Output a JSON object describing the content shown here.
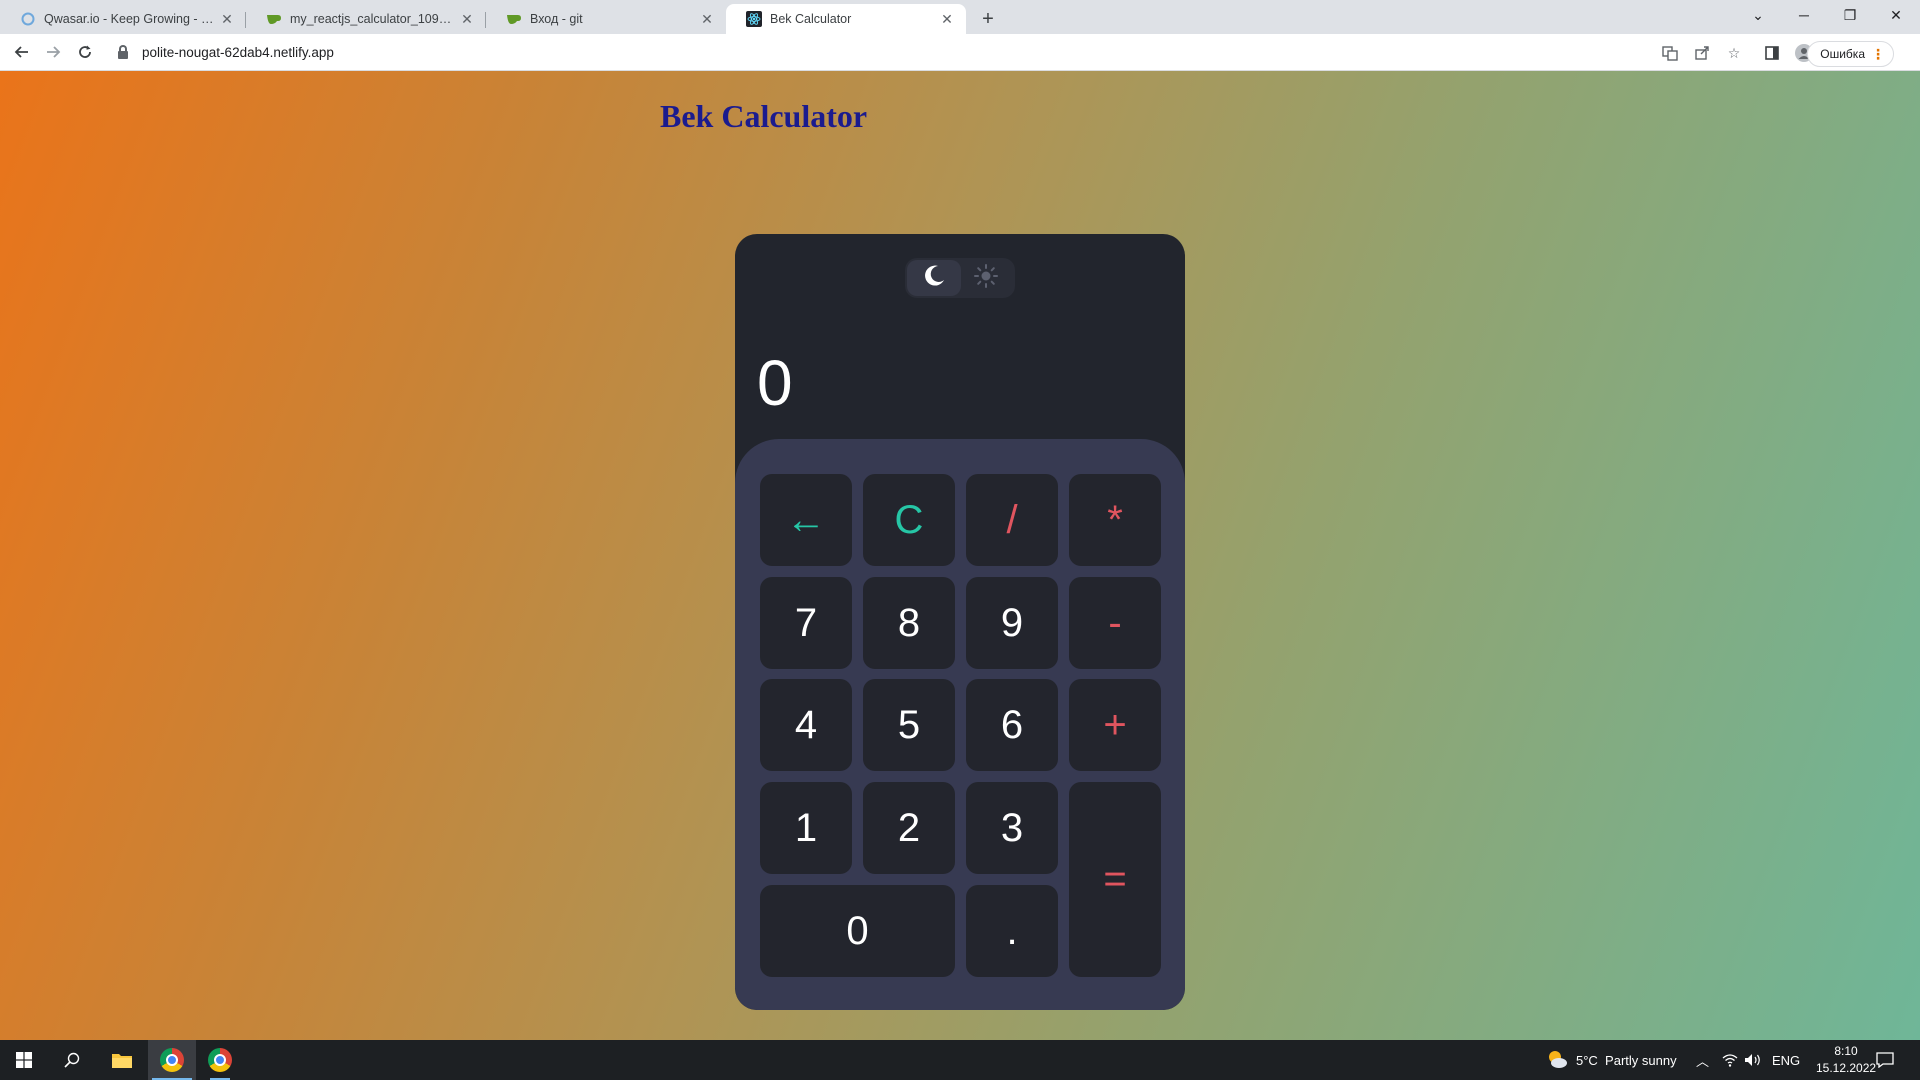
{
  "browser": {
    "tabs": [
      {
        "label": "Qwasar.io - Keep Growing - max",
        "icon": "qwasar-icon"
      },
      {
        "label": "my_reactjs_calculator_109740_or",
        "icon": "gitea-icon"
      },
      {
        "label": "Вход - git",
        "icon": "gitea-icon"
      },
      {
        "label": "Bek Calculator",
        "icon": "react-icon",
        "active": true
      }
    ],
    "url": "polite-nougat-62dab4.netlify.app",
    "error_button": "Ошибка"
  },
  "page": {
    "title": "Bek Calculator"
  },
  "calculator": {
    "display": "0",
    "theme": "dark",
    "keys": {
      "backspace": "←",
      "clear": "C",
      "divide": "/",
      "multiply": "*",
      "seven": "7",
      "eight": "8",
      "nine": "9",
      "minus": "-",
      "four": "4",
      "five": "5",
      "six": "6",
      "plus": "+",
      "one": "1",
      "two": "2",
      "three": "3",
      "equals": "=",
      "zero": "0",
      "dot": "."
    },
    "colors": {
      "accent_teal": "#26c6a6",
      "accent_red": "#e0555f",
      "body": "#22252d",
      "keypad": "#373a52"
    }
  },
  "taskbar": {
    "weather": "5°C  Partly sunny",
    "language": "ENG",
    "time": "8:10",
    "date": "15.12.2022"
  }
}
